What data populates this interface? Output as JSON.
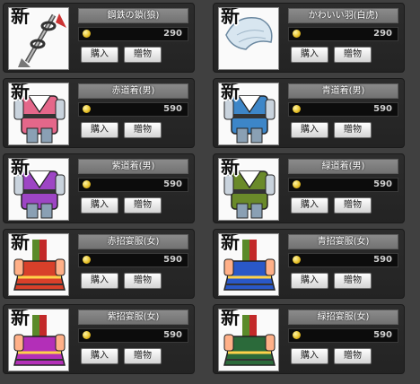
{
  "badge_text": "新",
  "buy_label": "購入",
  "gift_label": "贈物",
  "items": [
    {
      "name": "鋼鉄の鎖(狼)",
      "price": "290",
      "icon": "chain-icon",
      "color": "#9a9a9a"
    },
    {
      "name": "かわいい羽(白虎)",
      "price": "290",
      "icon": "wing-icon",
      "color": "#d8e6f0"
    },
    {
      "name": "赤道着(男)",
      "price": "590",
      "icon": "robe-icon",
      "color": "#e4678a"
    },
    {
      "name": "青道着(男)",
      "price": "590",
      "icon": "robe-icon",
      "color": "#3d86c8"
    },
    {
      "name": "紫道着(男)",
      "price": "590",
      "icon": "robe-icon",
      "color": "#9d45c4"
    },
    {
      "name": "緑道着(男)",
      "price": "590",
      "icon": "robe-icon",
      "color": "#6a8a2a"
    },
    {
      "name": "赤招宴服(女)",
      "price": "590",
      "icon": "dress-icon",
      "color": "#d8402a"
    },
    {
      "name": "青招宴服(女)",
      "price": "590",
      "icon": "dress-icon",
      "color": "#2a58c8"
    },
    {
      "name": "紫招宴服(女)",
      "price": "590",
      "icon": "dress-icon",
      "color": "#b32fb8"
    },
    {
      "name": "緑招宴服(女)",
      "price": "590",
      "icon": "dress-icon",
      "color": "#2b6a3a"
    }
  ]
}
